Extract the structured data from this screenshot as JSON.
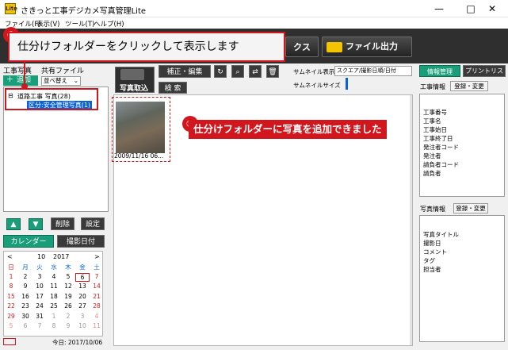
{
  "window": {
    "title": "さきっと工事デジカメ写真管理Lite",
    "app_icon_text": "Lite",
    "minimize": "—",
    "maximize": "□",
    "close": "✕"
  },
  "menu": [
    "ファイル(F)",
    "表示(V)",
    "ツール(T)",
    "ヘルプ(H)"
  ],
  "toolbar": {
    "partial_button": "クス",
    "file_output": "ファイル出力"
  },
  "callouts": {
    "one_number": "①",
    "one_text": "仕分けフォルダーをクリックして表示します",
    "two_number": "②",
    "two_text": "仕分けフォルダーに写真を追加できました"
  },
  "left": {
    "tab_photos": "工事写真",
    "tab_shared": "共有ファイル",
    "add_button": "追加",
    "sort_select": "並べ替え",
    "tree_root": "道路工事 写真(28)",
    "tree_child": "区分:安全管理写真(1)",
    "up_icon": "▲",
    "down_icon": "▼",
    "delete_button": "削除",
    "settings_button": "設定",
    "calendar_button": "カレンダー",
    "shot_date_button": "撮影日付"
  },
  "calendar": {
    "prev": "<",
    "next": ">",
    "month": "10",
    "year": "2017",
    "weekdays": [
      "日",
      "月",
      "火",
      "水",
      "木",
      "金",
      "土"
    ],
    "weeks": [
      [
        "1",
        "2",
        "3",
        "4",
        "5",
        "6",
        "7"
      ],
      [
        "8",
        "9",
        "10",
        "11",
        "12",
        "13",
        "14"
      ],
      [
        "15",
        "16",
        "17",
        "18",
        "19",
        "20",
        "21"
      ],
      [
        "22",
        "23",
        "24",
        "25",
        "26",
        "27",
        "28"
      ],
      [
        "29",
        "30",
        "31",
        "1",
        "2",
        "3",
        "4"
      ],
      [
        "5",
        "6",
        "7",
        "8",
        "9",
        "10",
        "11"
      ]
    ],
    "selected": "6",
    "today_label": "今日: 2017/10/06"
  },
  "center": {
    "photo_import": "写真取込",
    "edit_button": "補正・編集",
    "search_button": "検 索",
    "thumb_display_label": "サムネイル表示",
    "thumb_display_value": "スクエア/撮影日順/日付",
    "thumb_size_label": "サムネイルサイズ",
    "photo_caption": "2009/11/16 06..."
  },
  "right": {
    "tab_info": "情報管理",
    "tab_print": "プリントリスト",
    "work_info_label": "工事情報",
    "register_button": "登録・変更",
    "work_fields": [
      "工事番号",
      "工事名",
      "工事始日",
      "工事終了日",
      "発注者コード",
      "発注者",
      "請負者コード",
      "請負者"
    ],
    "photo_info_label": "写真情報",
    "photo_register_button": "登録・変更",
    "photo_fields": [
      "写真タイトル",
      "撮影日",
      "コメント",
      "タグ",
      "担当者"
    ]
  },
  "colors": {
    "accent_red": "#d2161d",
    "selection_blue": "#0a63d6",
    "toolbar_dark": "#2f2f2f",
    "green": "#1a9e7a"
  }
}
